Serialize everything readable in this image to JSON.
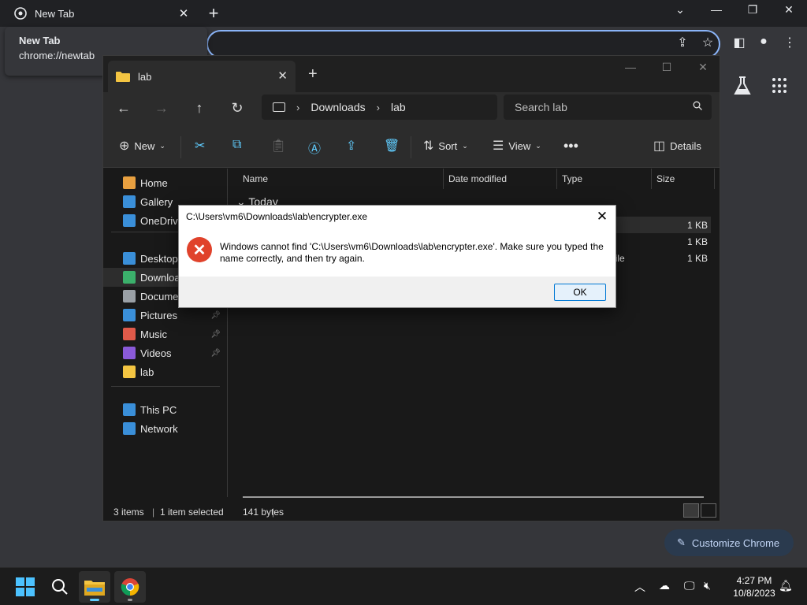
{
  "chrome": {
    "tab_title": "New Tab",
    "tooltip_title": "New Tab",
    "tooltip_url": "chrome://newtab",
    "customize_label": "Customize Chrome"
  },
  "explorer": {
    "tab_title": "lab",
    "breadcrumb": [
      "Downloads",
      "lab"
    ],
    "search_placeholder": "Search lab",
    "commands": {
      "new": "New",
      "sort": "Sort",
      "view": "View",
      "details": "Details"
    },
    "sidebar": [
      {
        "label": "Home",
        "icon": "home-icon",
        "color": "#e8a040"
      },
      {
        "label": "Gallery",
        "icon": "gallery-icon",
        "color": "#3a8fd9"
      },
      {
        "label": "OneDrive",
        "icon": "onedrive-icon",
        "color": "#3a8fd9"
      },
      {
        "label": "Desktop",
        "icon": "desktop-icon",
        "color": "#3a8fd9",
        "pinned": true
      },
      {
        "label": "Downloads",
        "icon": "downloads-icon",
        "color": "#3bb06b",
        "pinned": true,
        "selected": true
      },
      {
        "label": "Documents",
        "icon": "documents-icon",
        "color": "#9aa0a6",
        "pinned": true
      },
      {
        "label": "Pictures",
        "icon": "pictures-icon",
        "color": "#3a8fd9",
        "pinned": true
      },
      {
        "label": "Music",
        "icon": "music-icon",
        "color": "#e05a4a",
        "pinned": true
      },
      {
        "label": "Videos",
        "icon": "videos-icon",
        "color": "#8a5ad9",
        "pinned": true
      },
      {
        "label": "lab",
        "icon": "folder-icon",
        "color": "#f4c542"
      },
      {
        "label": "This PC",
        "icon": "thispc-icon",
        "color": "#3a8fd9"
      },
      {
        "label": "Network",
        "icon": "network-icon",
        "color": "#3a8fd9"
      }
    ],
    "columns": [
      "Name",
      "Date modified",
      "Type",
      "Size"
    ],
    "group": "Today",
    "rows": [
      {
        "type": "",
        "size": "1 KB"
      },
      {
        "type": "",
        "size": "1 KB"
      },
      {
        "type": "ot File",
        "size": "1 KB"
      }
    ],
    "status": {
      "items": "3 items",
      "selected": "1 item selected",
      "bytes": "141 bytes"
    }
  },
  "dialog": {
    "title": "C:\\Users\\vm6\\Downloads\\lab\\encrypter.exe",
    "message": "Windows cannot find 'C:\\Users\\vm6\\Downloads\\lab\\encrypter.exe'. Make sure you typed the name correctly, and then try again.",
    "ok_label": "OK"
  },
  "taskbar": {
    "time": "4:27 PM",
    "date": "10/8/2023"
  },
  "colors": {
    "accent": "#60cdff",
    "error": "#e0422b",
    "chrome_focus": "#8ab4f8"
  }
}
